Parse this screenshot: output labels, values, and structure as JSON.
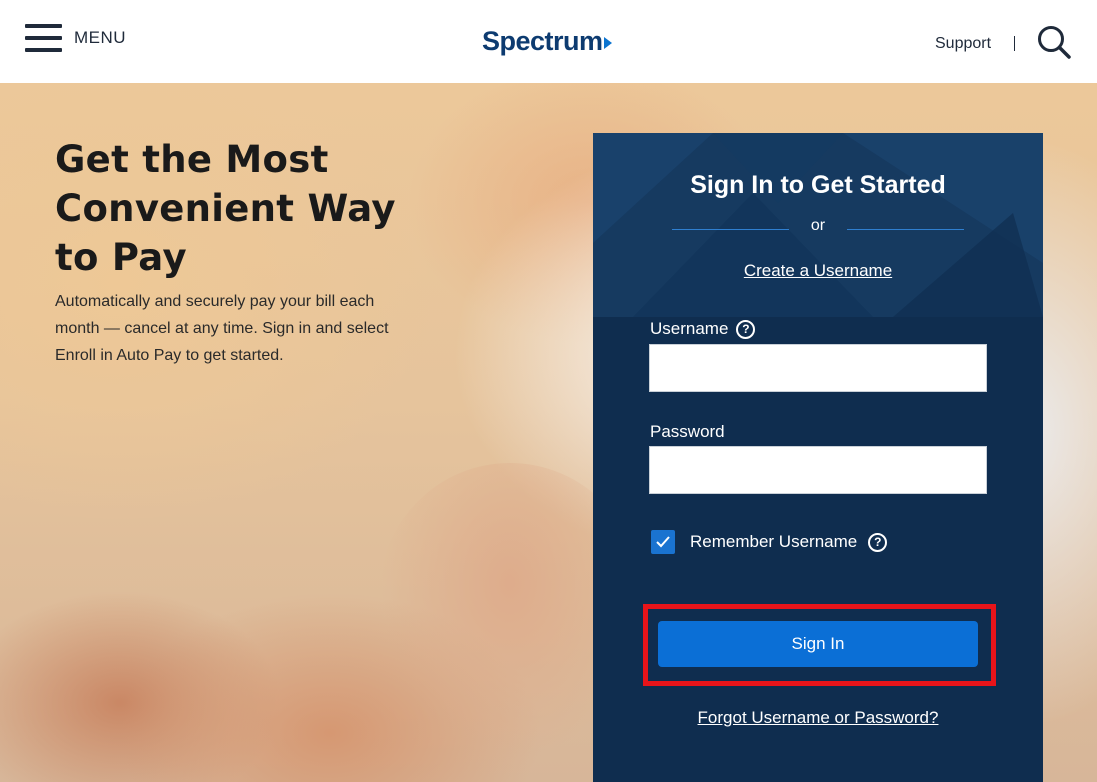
{
  "header": {
    "menu_label": "MENU",
    "logo_text": "Spectrum",
    "support_label": "Support"
  },
  "hero": {
    "title_line1": "Get the Most",
    "title_line2": "Convenient Way",
    "title_line3": "to Pay",
    "description": "Automatically and securely pay your bill each month — cancel at any time. Sign in and select Enroll in Auto Pay to get started."
  },
  "signin": {
    "title": "Sign In to Get Started",
    "or_text": "or",
    "create_link": "Create a Username",
    "username_label": "Username",
    "username_value": "",
    "password_label": "Password",
    "password_value": "",
    "remember_label": "Remember Username",
    "remember_checked": true,
    "submit_label": "Sign In",
    "forgot_link": "Forgot Username or Password?"
  },
  "icons": {
    "menu": "hamburger-icon",
    "search": "search-icon",
    "help": "question-circle-icon",
    "check": "check-icon"
  },
  "colors": {
    "brand": "#0d3b70",
    "panel": "#0f2d4f",
    "button": "#0b6fd6",
    "highlight": "#e8141a"
  }
}
